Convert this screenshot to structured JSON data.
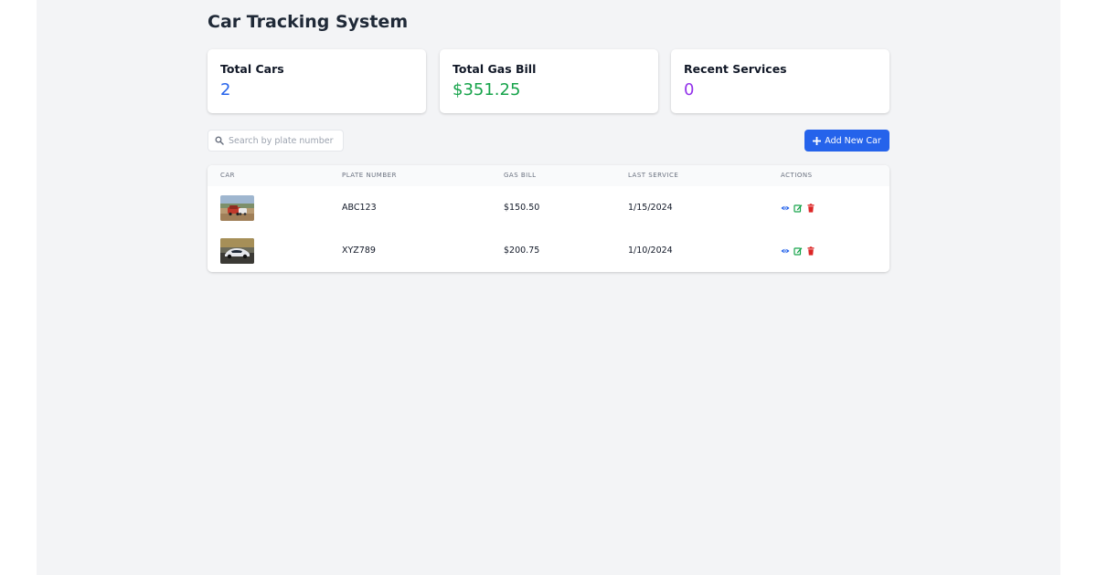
{
  "header": {
    "title": "Car Tracking System"
  },
  "stats": {
    "total_cars": {
      "label": "Total Cars",
      "value": "2",
      "color": "#2563eb"
    },
    "total_gas_bill": {
      "label": "Total Gas Bill",
      "value": "$351.25",
      "color": "#16a34a"
    },
    "recent_services": {
      "label": "Recent Services",
      "value": "0",
      "color": "#9333ea"
    }
  },
  "toolbar": {
    "search_placeholder": "Search by plate number",
    "add_label": "Add New Car",
    "add_color": "#2563eb"
  },
  "table": {
    "columns": [
      "Car",
      "Plate Number",
      "Gas Bill",
      "Last Service",
      "Actions"
    ],
    "rows": [
      {
        "plate": "ABC123",
        "gas_bill": "$150.50",
        "last_service": "1/15/2024",
        "image": "car-photo-red-suv"
      },
      {
        "plate": "XYZ789",
        "gas_bill": "$200.75",
        "last_service": "1/10/2024",
        "image": "car-photo-white-sports-car"
      }
    ],
    "action_icons": {
      "view": {
        "icon": "eye-icon",
        "color": "#2563eb"
      },
      "edit": {
        "icon": "edit-icon",
        "color": "#16a34a"
      },
      "delete": {
        "icon": "trash-icon",
        "color": "#dc2626"
      }
    }
  }
}
